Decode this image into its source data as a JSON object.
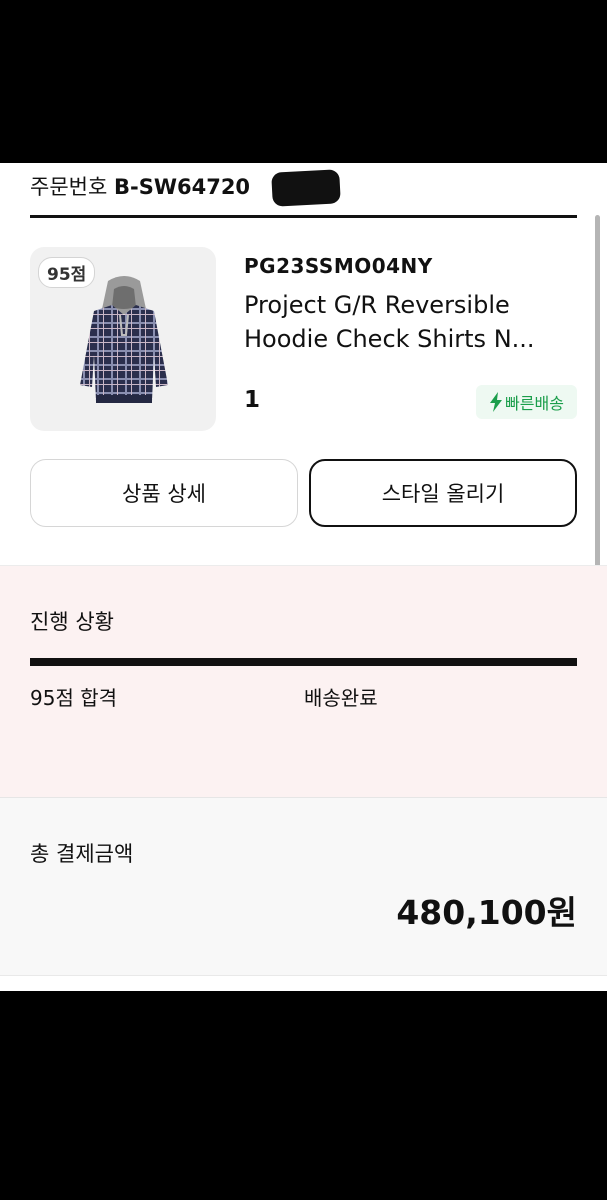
{
  "order": {
    "label": "주문번호",
    "number": "B-SW64720"
  },
  "product": {
    "score_badge": "95점",
    "code": "PG23SSMO04NY",
    "name_line1": "Project G/R Reversible",
    "name_line2": "Hoodie Check Shirts N...",
    "quantity": "1",
    "fast_delivery": "빠른배송"
  },
  "actions": {
    "detail_label": "상품 상세",
    "style_label": "스타일 올리기"
  },
  "progress": {
    "title": "진행 상황",
    "fill_fraction": 1.0,
    "steps": [
      "95점 합격",
      "배송완료"
    ]
  },
  "payment": {
    "title": "총 결제금액",
    "amount": "480,100원"
  },
  "colors": {
    "progress_fill": "#111111",
    "fast_delivery": "#1b9e4b",
    "progress_bg": "#fcf2f2"
  },
  "icons": {
    "fast_delivery": "lightning-bolt-icon"
  }
}
